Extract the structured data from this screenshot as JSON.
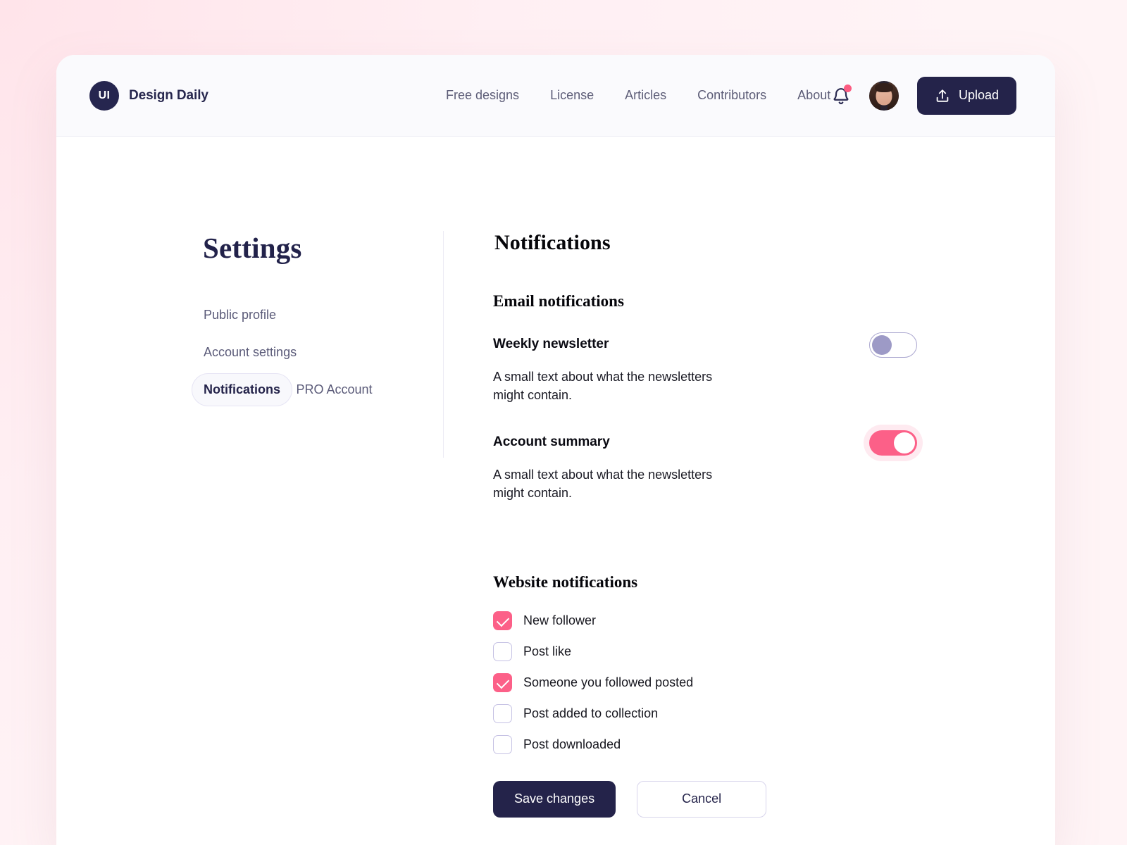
{
  "brand": {
    "mark": "UI",
    "name": "Design Daily"
  },
  "nav": {
    "items": [
      {
        "label": "Free designs"
      },
      {
        "label": "License"
      },
      {
        "label": "Articles"
      },
      {
        "label": "Contributors"
      },
      {
        "label": "About"
      }
    ]
  },
  "header_actions": {
    "notifications_icon": "bell-icon",
    "has_unread": true,
    "avatar_alt": "User avatar",
    "upload_label": "Upload",
    "upload_icon": "upload-icon"
  },
  "sidebar": {
    "title": "Settings",
    "items": [
      {
        "label": "Public profile",
        "active": false
      },
      {
        "label": "Account settings",
        "active": false
      },
      {
        "label": "Notifications",
        "active": true
      },
      {
        "label": "PRO Account",
        "active": false
      }
    ]
  },
  "content": {
    "title": "Notifications",
    "email_section": {
      "heading": "Email notifications",
      "prefs": [
        {
          "name": "Weekly newsletter",
          "description": "A small text about what the newsletters might contain.",
          "enabled": false
        },
        {
          "name": "Account summary",
          "description": "A small text about what the newsletters might contain.",
          "enabled": true
        }
      ]
    },
    "website_section": {
      "heading": "Website notifications",
      "options": [
        {
          "label": "New follower",
          "checked": true
        },
        {
          "label": "Post like",
          "checked": false
        },
        {
          "label": "Someone you followed posted",
          "checked": true
        },
        {
          "label": "Post added to collection",
          "checked": false
        },
        {
          "label": "Post downloaded",
          "checked": false
        }
      ]
    },
    "actions": {
      "save_label": "Save changes",
      "cancel_label": "Cancel"
    }
  },
  "colors": {
    "accent_pink": "#FC6088",
    "navy": "#24234A",
    "lavender_border": "#C6C2E4",
    "page_background": "#FFEFF3"
  }
}
